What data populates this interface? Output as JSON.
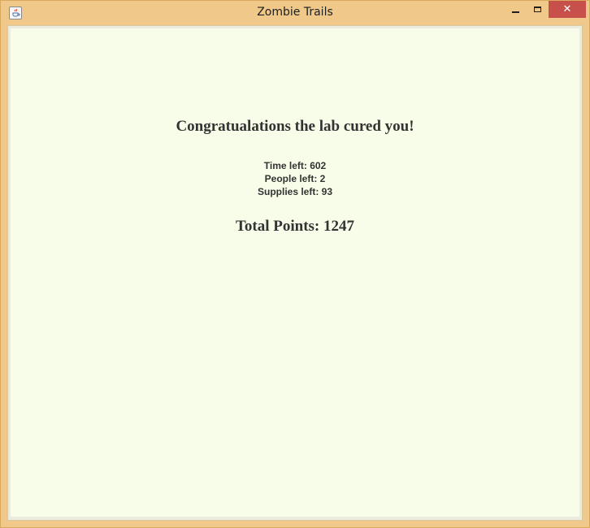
{
  "window": {
    "title": "Zombie Trails",
    "icon": "java-cup-icon",
    "controls": {
      "minimize": "minimize-icon",
      "maximize": "maximize-icon",
      "close": "close-icon",
      "close_glyph": "✕"
    }
  },
  "content": {
    "headline": "Congratualations the lab cured you!",
    "stats": {
      "time": "Time left: 602",
      "people": "People left: 2",
      "supplies": "Supplies left: 93"
    },
    "total": "Total Points: 1247"
  },
  "colors": {
    "window_frame": "#f0c98a",
    "panel_background": "#f7fde8",
    "close_button": "#c7504b",
    "text": "#333333"
  }
}
